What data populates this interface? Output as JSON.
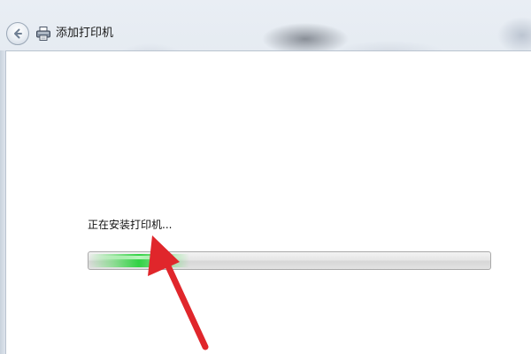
{
  "window": {
    "title": "添加打印机"
  },
  "status": {
    "message": "正在安装打印机..."
  },
  "progress": {
    "state": "indeterminate",
    "glow_fraction_start": 0.0,
    "glow_fraction_end": 0.25,
    "glow_color": "#2fd24a"
  },
  "annotation": {
    "arrow_color": "#e0262b",
    "points_to": "status-message"
  },
  "icons": {
    "back": "back-arrow-icon",
    "printer": "printer-icon"
  }
}
